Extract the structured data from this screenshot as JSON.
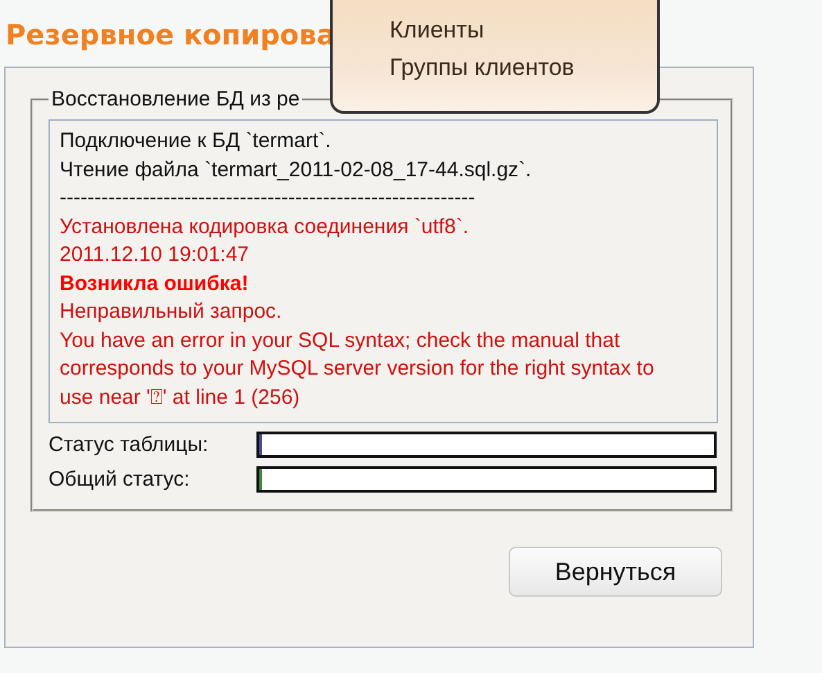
{
  "page_title": "Резервное копирова",
  "menu": {
    "items": [
      {
        "label": "Клиенты"
      },
      {
        "label": "Группы клиентов"
      }
    ]
  },
  "fieldset": {
    "legend": "Восстановление БД из ре",
    "log": [
      {
        "kind": "normal",
        "text": "Подключение к БД `termart`."
      },
      {
        "kind": "normal",
        "text": "Чтение файла `termart_2011-02-08_17-44.sql.gz`."
      },
      {
        "kind": "normal",
        "text": "------------------------------------------------------------"
      },
      {
        "kind": "error",
        "text": "Установлена кодировка соединения `utf8`."
      },
      {
        "kind": "error",
        "text": "2011.12.10 19:01:47"
      },
      {
        "kind": "error-bold",
        "text": "Возникла ошибка!"
      },
      {
        "kind": "error",
        "text": "Неправильный запрос."
      },
      {
        "kind": "error",
        "text": "You have an error in your SQL syntax; check the manual that corresponds to your MySQL server version for the right syntax to use near '⍰' at line 1 (256)"
      }
    ],
    "progress": [
      {
        "label": "Статус таблицы:",
        "level": 0.004,
        "color": "#4a4aa0"
      },
      {
        "label": "Общий статус:",
        "level": 0.004,
        "color": "#3a8a3a"
      }
    ]
  },
  "buttons": [
    "Вернуться"
  ]
}
